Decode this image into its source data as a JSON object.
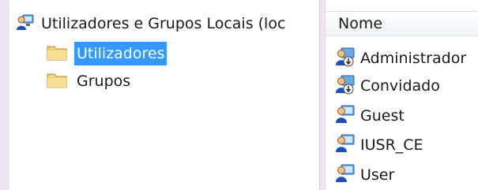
{
  "tree": {
    "root_label": "Utilizadores e Grupos Locais (loc",
    "items": [
      {
        "label": "Utilizadores",
        "selected": true
      },
      {
        "label": "Grupos",
        "selected": false
      }
    ]
  },
  "list": {
    "column_header": "Nome",
    "rows": [
      {
        "name": "Administrador",
        "icon": "disabled-user-icon"
      },
      {
        "name": "Convidado",
        "icon": "disabled-user-icon"
      },
      {
        "name": "Guest",
        "icon": "user-icon"
      },
      {
        "name": "IUSR_CE",
        "icon": "user-icon"
      },
      {
        "name": "User",
        "icon": "user-icon"
      }
    ]
  },
  "colors": {
    "selection": "#3399ff",
    "background": "#ece6f3",
    "folder": "#f3d37a"
  }
}
